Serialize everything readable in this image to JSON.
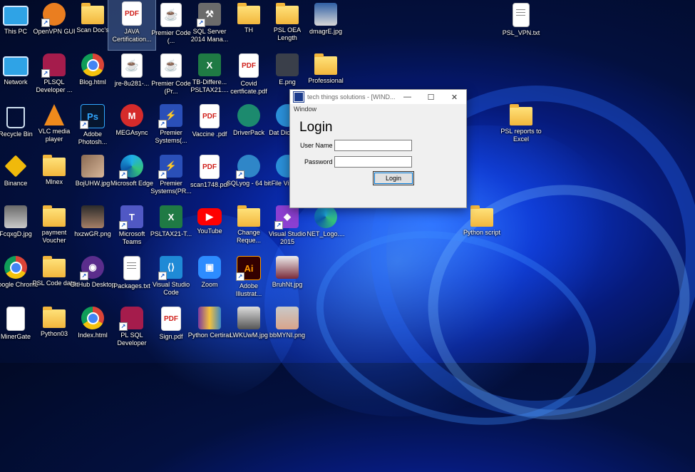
{
  "desktop": {
    "icons": [
      {
        "label": "This PC",
        "type": "monitor"
      },
      {
        "label": "OpenVPN GUI",
        "type": "vpn"
      },
      {
        "label": "Scan Doc's",
        "type": "folder"
      },
      {
        "label": "JAVA Certification...",
        "type": "pdf"
      },
      {
        "label": "Premier Code (...",
        "type": "java"
      },
      {
        "label": "SQL Server 2014 Mana...",
        "type": "sql"
      },
      {
        "label": "TH",
        "type": "folder"
      },
      {
        "label": "PSL OEA Length",
        "type": "folder"
      },
      {
        "label": "dmagrE.jpg",
        "type": "image"
      },
      {
        "label": "PSL_VPN.txt",
        "type": "txt"
      },
      {
        "label": "Network",
        "type": "network"
      },
      {
        "label": "PLSQL Developer ...",
        "type": "db"
      },
      {
        "label": "Blog.html",
        "type": "chrome"
      },
      {
        "label": "jre-8u281-...",
        "type": "java"
      },
      {
        "label": "Premier Code (Pr...",
        "type": "java"
      },
      {
        "label": "TB-Differe... PSLTAX21....",
        "type": "excel"
      },
      {
        "label": "Covid certficate.pdf",
        "type": "pdf"
      },
      {
        "label": "E.png",
        "type": "image"
      },
      {
        "label": "Professional",
        "type": "folder"
      },
      {
        "label": "Recycle Bin",
        "type": "recycle"
      },
      {
        "label": "VLC media player",
        "type": "vlc"
      },
      {
        "label": "Adobe Photosh...",
        "type": "ps"
      },
      {
        "label": "MEGAsync",
        "type": "mega"
      },
      {
        "label": "Premier Systems(...",
        "type": "app"
      },
      {
        "label": "Vaccine .pdf",
        "type": "pdf"
      },
      {
        "label": "DriverPack",
        "type": "app"
      },
      {
        "label": "Dat Diction...",
        "type": "app"
      },
      {
        "label": "PSL reports to Excel",
        "type": "folder"
      },
      {
        "label": "Binance",
        "type": "binance"
      },
      {
        "label": "Mlnex",
        "type": "folder"
      },
      {
        "label": "BojUHW.jpg",
        "type": "image"
      },
      {
        "label": "Microsoft Edge",
        "type": "edge"
      },
      {
        "label": "Premier Systems(PR...",
        "type": "app"
      },
      {
        "label": "scan1748.pdf",
        "type": "pdf"
      },
      {
        "label": "SQLyog - 64 bit",
        "type": "app"
      },
      {
        "label": "File Vi Plus",
        "type": "app"
      },
      {
        "label": "FcqxgD.jpg",
        "type": "image"
      },
      {
        "label": "payment Voucher",
        "type": "folder"
      },
      {
        "label": "hxzwGR.png",
        "type": "image"
      },
      {
        "label": "Microsoft Teams",
        "type": "teams"
      },
      {
        "label": "PSLTAX21-T...",
        "type": "excel"
      },
      {
        "label": "YouTube",
        "type": "youtube"
      },
      {
        "label": "Change Reque...",
        "type": "folder"
      },
      {
        "label": "Visual Studio 2015",
        "type": "vs"
      },
      {
        "label": "NET_Logo....",
        "type": "edge"
      },
      {
        "label": "Python script",
        "type": "folder"
      },
      {
        "label": "Google Chrome",
        "type": "chrome"
      },
      {
        "label": "PSL Code data",
        "type": "folder"
      },
      {
        "label": "GitHub Desktop",
        "type": "github"
      },
      {
        "label": "Packages.txt",
        "type": "txt"
      },
      {
        "label": "Visual Studio Code",
        "type": "vscode"
      },
      {
        "label": "Zoom",
        "type": "zoom"
      },
      {
        "label": "Adobe Illustrat...",
        "type": "ai"
      },
      {
        "label": "BruhNt.jpg",
        "type": "image"
      },
      {
        "label": "MinerGate",
        "type": "doc"
      },
      {
        "label": "Python03",
        "type": "folder"
      },
      {
        "label": "Index.html",
        "type": "chrome"
      },
      {
        "label": "PL SQL Developer",
        "type": "db"
      },
      {
        "label": "Sign.pdf",
        "type": "pdf"
      },
      {
        "label": "Python Certirar",
        "type": "rar"
      },
      {
        "label": "LWKUwM.jpg",
        "type": "image"
      },
      {
        "label": "bbMYNI.png",
        "type": "image"
      }
    ]
  },
  "login_window": {
    "title": "tech things solutions - [WIND...",
    "minimize": "—",
    "maximize": "☐",
    "close": "✕",
    "menu": "Window",
    "heading": "Login",
    "username_label": "User Name",
    "username_value": "",
    "password_label": "Password",
    "password_value": "",
    "login_button": "Login"
  }
}
